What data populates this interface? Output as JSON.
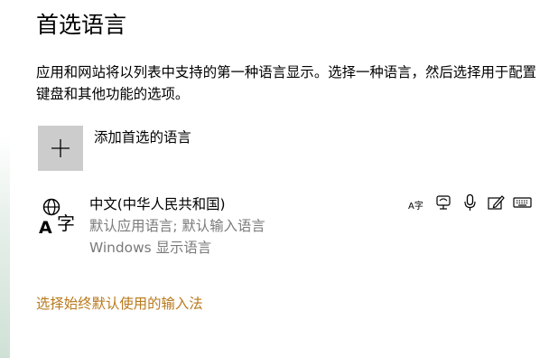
{
  "page": {
    "title": "首选语言",
    "description": "应用和网站将以列表中支持的第一种语言显示。选择一种语言，然后选择用于配置键盘和其他功能的选项。"
  },
  "add_language": {
    "label": "添加首选的语言",
    "icon": "plus-icon"
  },
  "languages": [
    {
      "name": "中文(中华人民共和国)",
      "detail_line1": "默认应用语言; 默认输入语言",
      "detail_line2": "Windows 显示语言",
      "icon": "language-globe-icon",
      "icon_glyph": "字",
      "icon_letter": "A",
      "features": [
        {
          "icon": "display-language-icon",
          "glyph": "A字"
        },
        {
          "icon": "speech-recognition-icon"
        },
        {
          "icon": "text-to-speech-icon"
        },
        {
          "icon": "handwriting-icon"
        },
        {
          "icon": "keyboard-icon"
        }
      ]
    }
  ],
  "link": {
    "label": "选择始终默认使用的输入法"
  },
  "colors": {
    "accent_link": "#b9791c",
    "secondary_text": "#7a7a7a",
    "plus_tile": "#cccccc"
  }
}
